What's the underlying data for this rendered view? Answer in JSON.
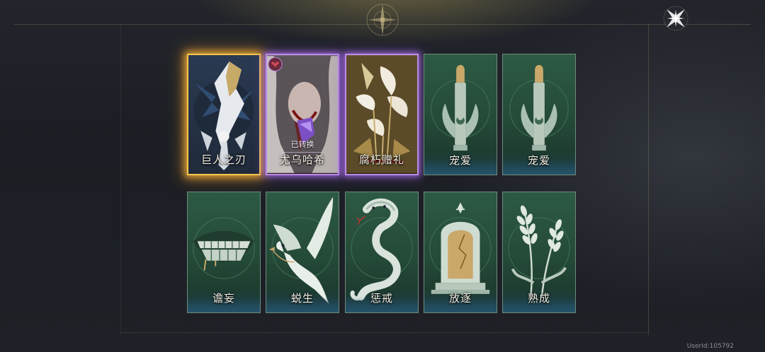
{
  "user_id": "UserId:105792",
  "close_icon": "star-close-icon",
  "cards_row1": [
    {
      "label": "巨人之刃",
      "rarity": "gold",
      "icon": "giant-blade-icon"
    },
    {
      "label": "尤乌哈希",
      "rarity": "purple",
      "status": "已转换",
      "icon": "character-portrait-icon"
    },
    {
      "label": "腐朽赠礼",
      "rarity": "purple",
      "icon": "lily-icon"
    },
    {
      "label": "宠爱",
      "rarity": "green",
      "icon": "bullet-icon"
    },
    {
      "label": "宠爱",
      "rarity": "green",
      "icon": "bullet-icon"
    }
  ],
  "cards_row2": [
    {
      "label": "谵妄",
      "rarity": "green",
      "icon": "teeth-grin-icon"
    },
    {
      "label": "蜕生",
      "rarity": "green",
      "icon": "dove-icon"
    },
    {
      "label": "惩戒",
      "rarity": "green",
      "icon": "cobra-icon"
    },
    {
      "label": "放逐",
      "rarity": "green",
      "icon": "tombstone-icon"
    },
    {
      "label": "熟成",
      "rarity": "green",
      "icon": "wheat-icon"
    }
  ],
  "colors": {
    "gold_glow": "#f7c64a",
    "purple_glow": "#b98ce8",
    "green_card": "#2d5a44"
  }
}
